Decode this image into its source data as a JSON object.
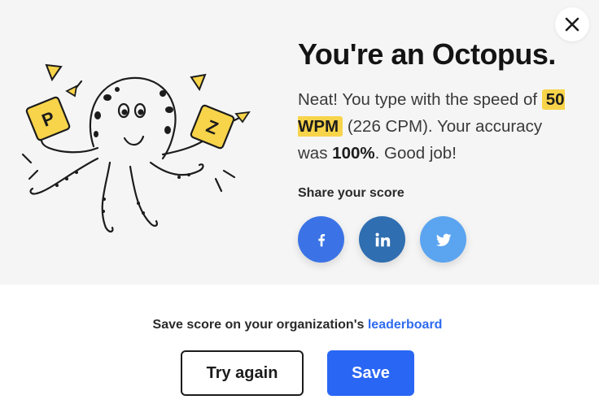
{
  "result": {
    "title": "You're an Octopus.",
    "desc_prefix": "Neat! You type with the speed of",
    "wpm": "50 WPM",
    "cpm": "(226 CPM). Your accuracy was",
    "accuracy": "100%",
    "desc_suffix": ". Good job!"
  },
  "share": {
    "label": "Share your score",
    "buttons": [
      "facebook-icon",
      "linkedin-icon",
      "twitter-icon"
    ]
  },
  "footer": {
    "save_text": "Save score on your organization's",
    "leaderboard_link": "leaderboard",
    "try_again": "Try again",
    "save": "Save"
  },
  "illustration": {
    "tile_letters": [
      "P",
      "Z"
    ]
  },
  "colors": {
    "accent_blue": "#2966f4",
    "badge_yellow": "#f8d44a",
    "facebook": "#3b73e6",
    "linkedin": "#2f6eb0",
    "twitter": "#5ba4f0",
    "panel_bg": "#f5f5f5"
  }
}
